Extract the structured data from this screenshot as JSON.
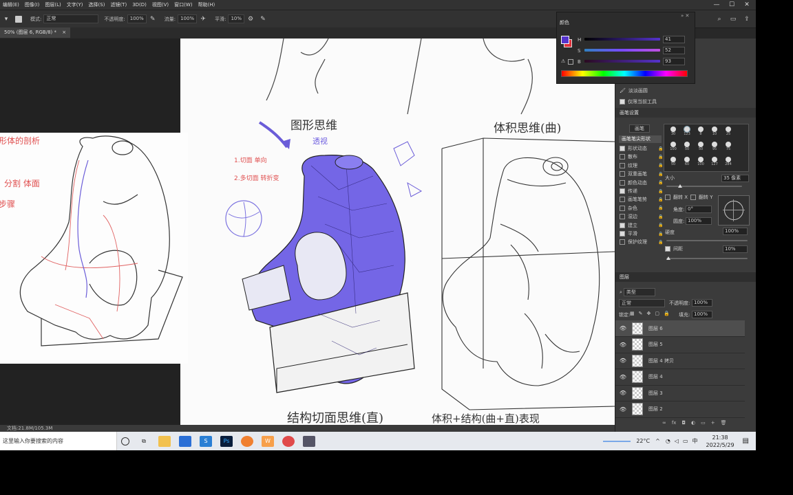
{
  "app": {
    "menu": [
      "编辑(E)",
      "图像(I)",
      "图层(L)",
      "文字(Y)",
      "选择(S)",
      "滤镜(T)",
      "3D(D)",
      "视图(V)",
      "窗口(W)",
      "帮助(H)"
    ],
    "window_controls": [
      "—",
      "☐",
      "✕"
    ]
  },
  "options_bar": {
    "mode_label": "模式:",
    "mode_value": "正常",
    "opacity_label": "不透明度:",
    "opacity_value": "100%",
    "flow_label": "流量:",
    "flow_value": "100%",
    "smooth_label": "平滑:",
    "smooth_value": "10%"
  },
  "document_tab": {
    "title": "50% (图层 6, RGB/8) *",
    "close": "×"
  },
  "status_bar": {
    "doc_info": "文档:21.8M/105.3M"
  },
  "color_panel": {
    "title": "颜色",
    "foreground": "#5533cc",
    "background": "#e0303a",
    "channels": [
      {
        "label": "H",
        "value": "41"
      },
      {
        "label": "S",
        "value": "52"
      },
      {
        "label": "B",
        "value": "93"
      }
    ]
  },
  "brush_panel": {
    "title": "画笔设置",
    "preset_button": "画笔",
    "tip_shape_label": "画笔笔尖形状",
    "options": [
      {
        "label": "形状动态",
        "checked": true
      },
      {
        "label": "散布",
        "checked": false
      },
      {
        "label": "纹理",
        "checked": false
      },
      {
        "label": "双重画笔",
        "checked": false
      },
      {
        "label": "颜色动态",
        "checked": false
      },
      {
        "label": "传递",
        "checked": true
      },
      {
        "label": "画笔笔势",
        "checked": false
      },
      {
        "label": "杂色",
        "checked": false
      },
      {
        "label": "湿边",
        "checked": false
      },
      {
        "label": "建立",
        "checked": true
      },
      {
        "label": "平滑",
        "checked": true
      },
      {
        "label": "保护纹理",
        "checked": false
      }
    ],
    "brush_sizes": [
      "30",
      "123",
      "8",
      "10",
      "25",
      "100",
      "50",
      "50",
      "95",
      "75",
      "50",
      "60",
      "100",
      "127",
      "284"
    ],
    "size_label": "大小",
    "size_value": "35 像素",
    "flip_x": "翻转 X",
    "flip_y": "翻转 Y",
    "angle_label": "角度:",
    "angle_value": "0°",
    "roundness_label": "圆度:",
    "roundness_value": "100%",
    "hardness_label": "硬度",
    "hardness_value": "100%",
    "spacing_label": "间距",
    "spacing_value": "10%",
    "tool_items": [
      "淡淡画圆",
      "仅限当前工具"
    ]
  },
  "layers_panel": {
    "title": "图层",
    "kind_label": "类型",
    "blend_mode": "正常",
    "opacity_label": "不透明度:",
    "opacity_value": "100%",
    "lock_label": "锁定:",
    "fill_label": "填充:",
    "fill_value": "100%",
    "layers": [
      {
        "name": "图层 6",
        "active": true
      },
      {
        "name": "图层 5",
        "active": false
      },
      {
        "name": "图层 4 拷贝",
        "active": false
      },
      {
        "name": "图层 4",
        "active": false
      },
      {
        "name": "图层 3",
        "active": false
      },
      {
        "name": "图层 2",
        "active": false
      }
    ]
  },
  "artwork": {
    "heading_left": "图形思维",
    "heading_right": "体积思维(曲)",
    "heading_bottom_left": "结构切面思维(直)",
    "heading_bottom_right": "体积+结构(曲+直)表现",
    "annotation_small_1": "1.切面  单向",
    "annotation_small_2": "2.多切面 转折变",
    "annotation_blue": "透视",
    "ref_notes": [
      "形体的剖析",
      "分割 体面",
      "步骤"
    ]
  },
  "taskbar": {
    "search_placeholder": "这里输入你要搜索的内容",
    "temperature": "22°C",
    "time": "21:38",
    "date": "2022/5/29",
    "apps": [
      "cortana",
      "task-view",
      "explorer",
      "store",
      "ps-ide",
      "photoshop",
      "browser-orange",
      "browser-w",
      "browser-360",
      "app-person"
    ]
  }
}
